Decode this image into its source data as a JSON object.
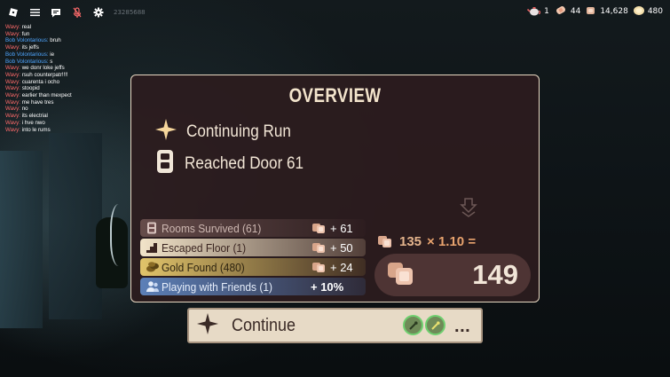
{
  "topbar": {
    "user_id": "23285688",
    "icons": [
      "roblox-logo-icon",
      "menu-icon",
      "chat-icon",
      "mic-muted-icon",
      "settings-icon"
    ]
  },
  "stats": [
    {
      "icon": "teapot-icon",
      "value": "1"
    },
    {
      "icon": "bandage-icon",
      "value": "44"
    },
    {
      "icon": "knob-icon",
      "value": "14,628"
    },
    {
      "icon": "gold-icon",
      "value": "480"
    }
  ],
  "chat": [
    {
      "name": "Wavy:",
      "msg": "real",
      "color": "red"
    },
    {
      "name": "Wavy:",
      "msg": "fun",
      "color": "red"
    },
    {
      "name": "Bob Volontarious:",
      "msg": "bruh",
      "color": "blue"
    },
    {
      "name": "Wavy:",
      "msg": "its jeffs",
      "color": "red"
    },
    {
      "name": "Bob Volontarious:",
      "msg": "ie",
      "color": "blue"
    },
    {
      "name": "Bob Volontarious:",
      "msg": "s",
      "color": "blue"
    },
    {
      "name": "Wavy:",
      "msg": "we donr loke jeffs",
      "color": "red"
    },
    {
      "name": "Wavy:",
      "msg": "rsuh counterpatr!!!!",
      "color": "red"
    },
    {
      "name": "Wavy:",
      "msg": "cuarenta i ocho",
      "color": "red"
    },
    {
      "name": "Wavy:",
      "msg": "stoopid",
      "color": "red"
    },
    {
      "name": "Wavy:",
      "msg": "earlier than mexpect",
      "color": "red"
    },
    {
      "name": "Wavy:",
      "msg": "me have tres",
      "color": "red"
    },
    {
      "name": "Wavy:",
      "msg": "no",
      "color": "red"
    },
    {
      "name": "Wavy:",
      "msg": "its electrial",
      "color": "red"
    },
    {
      "name": "Wavy:",
      "msg": "i hve nwo",
      "color": "red"
    },
    {
      "name": "Wavy:",
      "msg": "into le rums",
      "color": "red"
    }
  ],
  "overview": {
    "title": "OVERVIEW",
    "run_status": "Continuing Run",
    "door": "Reached Door 61",
    "rows": [
      {
        "label": "Rooms Survived (61)",
        "value": "+ 61",
        "icon": "door-icon"
      },
      {
        "label": "Escaped Floor (1)",
        "value": "+ 50",
        "icon": "stairs-icon"
      },
      {
        "label": "Gold Found (480)",
        "value": "+ 24",
        "icon": "gold-coins-icon"
      },
      {
        "label": "Playing with Friends (1)",
        "value": "+ 10%",
        "icon": "friends-icon"
      }
    ],
    "subtotal": "135",
    "multiplier": "× 1.10 =",
    "total": "149"
  },
  "continue_button": {
    "label": "Continue",
    "more": "..."
  },
  "colors": {
    "panel_bg": "#2c1c1e",
    "panel_border": "#e8d8c2",
    "accent_knob": "#d8a58a",
    "friends_bar": "#5c80b8",
    "gold_bar": "#e1c46a"
  }
}
